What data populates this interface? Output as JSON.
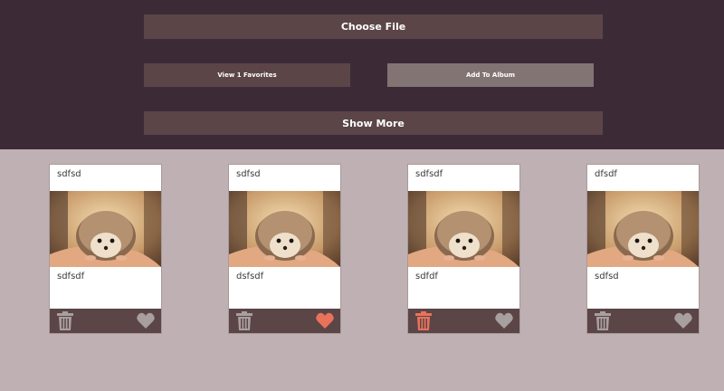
{
  "toolbar": {
    "choose_file": "Choose File",
    "view_favorites": "View 1 Favorites",
    "add_to_album": "Add To Album",
    "show_more": "Show More"
  },
  "colors": {
    "header_bg": "#3c2b37",
    "button_bg": "#5b4547",
    "button_light_bg": "#837474",
    "page_bg": "#bfb0b3",
    "icon_default": "#a89f9f",
    "icon_active": "#e8735a"
  },
  "cards": [
    {
      "title": "sdfsd",
      "description": "sdfsdf",
      "image": "hedgehog-photo",
      "trash_active": false,
      "favorited": false
    },
    {
      "title": "sdfsd",
      "description": "dsfsdf",
      "image": "hedgehog-photo",
      "trash_active": false,
      "favorited": true
    },
    {
      "title": "sdfsdf",
      "description": "sdfdf",
      "image": "hedgehog-photo",
      "trash_active": true,
      "favorited": false
    },
    {
      "title": "dfsdf",
      "description": "sdfsd",
      "image": "hedgehog-photo",
      "trash_active": false,
      "favorited": false
    }
  ]
}
